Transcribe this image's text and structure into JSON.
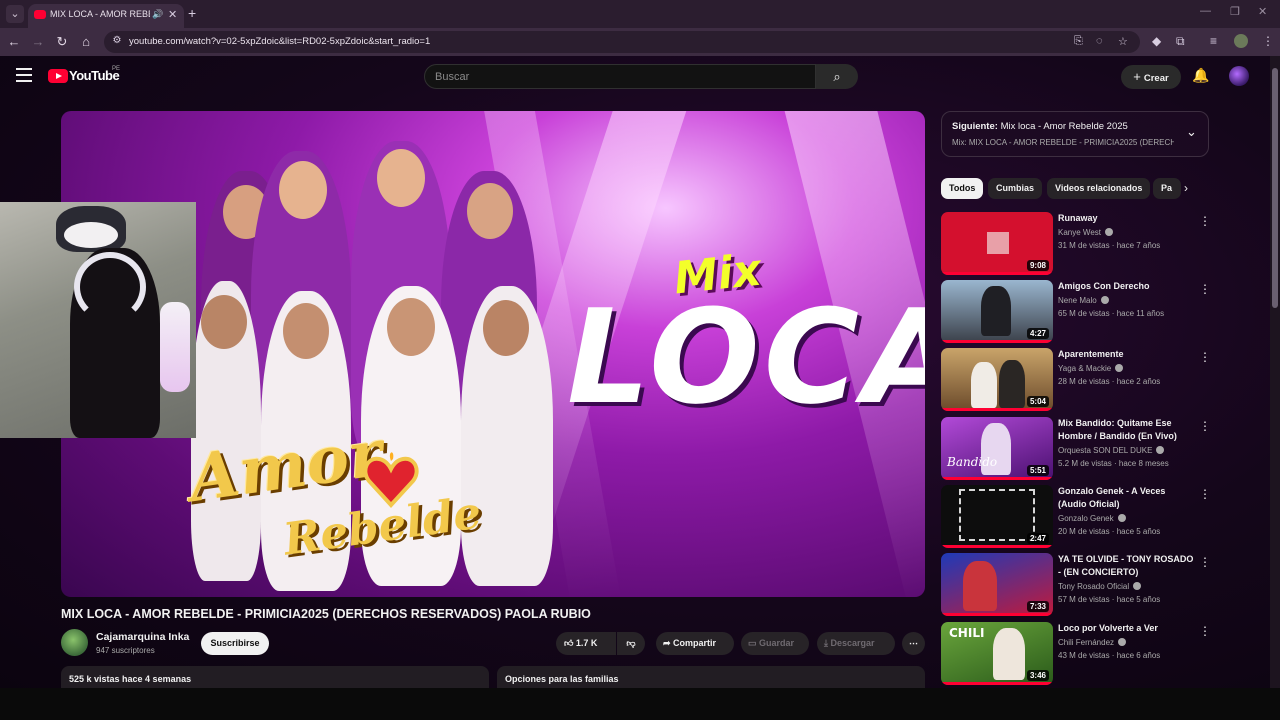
{
  "browser": {
    "tab_title": "MIX LOCA - AMOR REBELDE",
    "url": "youtube.com/watch?v=02-5xpZdoic&list=RD02-5xpZdoic&start_radio=1"
  },
  "masthead": {
    "logo_text": "YouTube",
    "region": "PE",
    "search_placeholder": "Buscar",
    "create_label": "Crear"
  },
  "player": {
    "thumb_mix": "Mix",
    "thumb_loca": "LOCA",
    "thumb_amor": "Amor",
    "thumb_rebelde": "Rebelde"
  },
  "video": {
    "title": "MIX LOCA - AMOR REBELDE - PRIMICIA2025 (DERECHOS RESERVADOS) PAOLA RUBIO",
    "channel": "Cajamarquina Inka",
    "subscribers": "947 suscriptores",
    "subscribe_label": "Suscribirse",
    "likes": "1.7 K",
    "share_label": "Compartir",
    "save_label": "Guardar",
    "download_label": "Descargar",
    "stats": "525 k vistas  hace 4 semanas",
    "family_label": "Opciones para las familias"
  },
  "mix_panel": {
    "next_prefix": "Siguiente:",
    "next_title": "Mix loca - Amor Rebelde 2025",
    "subtitle": "Mix: MIX LOCA - AMOR REBELDE - PRIMICIA2025 (DERECH..."
  },
  "chips": [
    "Todos",
    "Cumbias",
    "Videos relacionados",
    "Pa"
  ],
  "recommendations": [
    {
      "title": "Runaway",
      "channel": "Kanye West",
      "meta": "31 M de vistas · hace 7 años",
      "duration": "9:08"
    },
    {
      "title": "Amigos Con Derecho",
      "channel": "Nene Malo",
      "meta": "65 M de vistas · hace 11 años",
      "duration": "4:27"
    },
    {
      "title": "Aparentemente",
      "channel": "Yaga & Mackie",
      "meta": "28 M de vistas · hace 2 años",
      "duration": "5:04"
    },
    {
      "title": "Mix Bandido: Quitame Ese Hombre / Bandido (En Vivo)",
      "channel": "Orquesta SON DEL DUKE",
      "meta": "5.2 M de vistas · hace 8 meses",
      "duration": "5:51"
    },
    {
      "title": "Gonzalo Genek - A Veces (Audio Oficial)",
      "channel": "Gonzalo Genek",
      "meta": "20 M de vistas · hace 5 años",
      "duration": "2:47"
    },
    {
      "title": "YA TE OLVIDE - TONY ROSADO - (EN CONCIERTO)",
      "channel": "Tony Rosado Oficial",
      "meta": "57 M de vistas · hace 5 años",
      "duration": "7:33"
    },
    {
      "title": "Loco por Volverte a Ver",
      "channel": "Chili Fernández",
      "meta": "43 M de vistas · hace 6 años",
      "duration": "3:46"
    }
  ],
  "thumb_texts": [
    "CHILI",
    "Bandido"
  ],
  "colors": {
    "accent": "#ff0033",
    "background": "#0f0f0f"
  }
}
